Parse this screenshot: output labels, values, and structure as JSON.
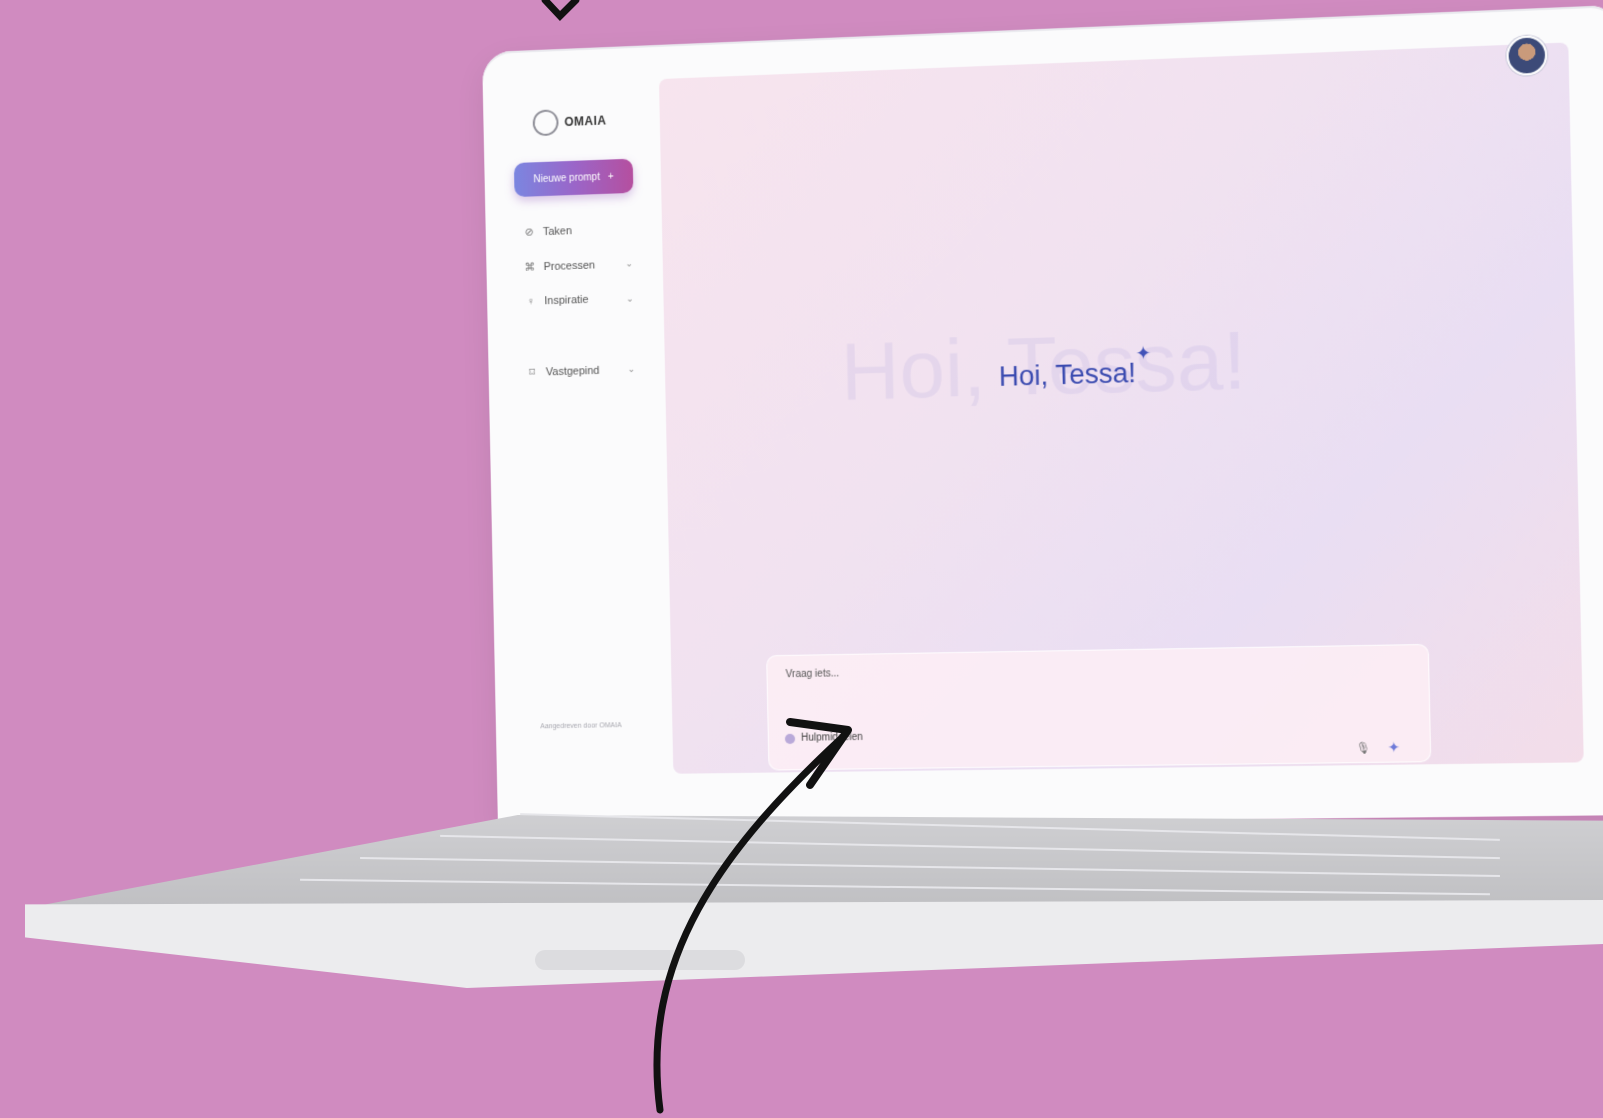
{
  "brand": {
    "name": "OMAIA",
    "logo_icon": "omaia-logo-icon"
  },
  "sidebar": {
    "new_prompt_label": "Nieuwe prompt",
    "new_prompt_icon": "+",
    "items": [
      {
        "label": "Taken",
        "icon": "check-circle-icon",
        "has_chevron": false
      },
      {
        "label": "Processen",
        "icon": "flow-icon",
        "has_chevron": true
      },
      {
        "label": "Inspiratie",
        "icon": "lightbulb-icon",
        "has_chevron": true
      },
      {
        "label": "Vastgepind",
        "icon": "pin-icon",
        "has_chevron": true
      }
    ],
    "footer": "Aangedreven door OMAIA"
  },
  "main": {
    "greeting": "Hoi, Tessa!",
    "prompt": {
      "placeholder": "Vraag iets...",
      "attach_label": "Hulpmiddelen"
    }
  },
  "colors": {
    "background": "#d08bc0",
    "accent": "#3b4bb0",
    "button_gradient_start": "#7b86e0",
    "button_gradient_end": "#b54f9f"
  }
}
